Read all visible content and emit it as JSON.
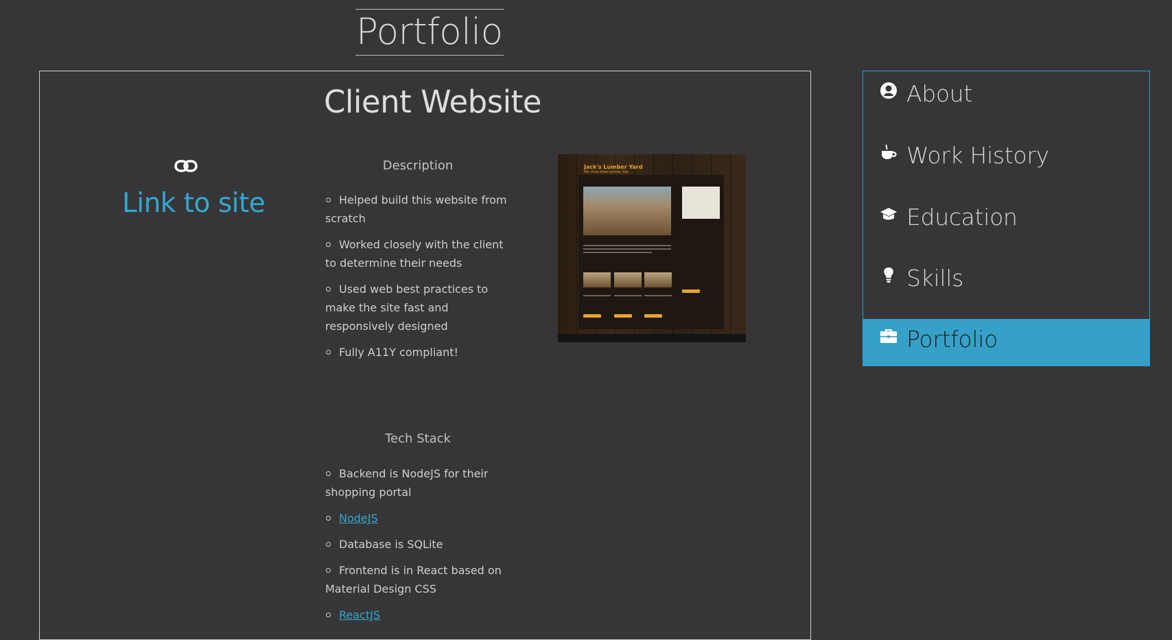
{
  "page": {
    "title": "Portfolio"
  },
  "project": {
    "title": "Client Website",
    "link_label": "Link to site",
    "description_heading": "Description",
    "description_items": [
      "Helped build this website from scratch",
      "Worked closely with the client to determine their needs",
      "Used web best practices to make the site fast and responsively designed",
      "Fully A11Y compliant!"
    ],
    "tech_heading": "Tech Stack",
    "tech_items": [
      {
        "text": "Backend is NodeJS for their shopping portal",
        "link": false
      },
      {
        "text": "NodeJS",
        "link": true
      },
      {
        "text": "Database is SQLite",
        "link": false
      },
      {
        "text": "Frontend is in React based on Material Design CSS",
        "link": false
      },
      {
        "text": "ReactJS",
        "link": true
      }
    ],
    "screenshot": {
      "site_title": "Jack's Lumber Yard",
      "site_tagline": "We chop down prices, too."
    }
  },
  "nav": {
    "items": [
      {
        "label": "About",
        "icon": "user-icon",
        "active": false
      },
      {
        "label": "Work History",
        "icon": "coffee-cup-icon",
        "active": false
      },
      {
        "label": "Education",
        "icon": "graduation-cap-icon",
        "active": false
      },
      {
        "label": "Skills",
        "icon": "lightbulb-icon",
        "active": false
      },
      {
        "label": "Portfolio",
        "icon": "briefcase-icon",
        "active": true
      }
    ]
  },
  "colors": {
    "background": "#363638",
    "accent": "#35a1c8",
    "link": "#35a7cf",
    "text": "#cfcfcf"
  }
}
